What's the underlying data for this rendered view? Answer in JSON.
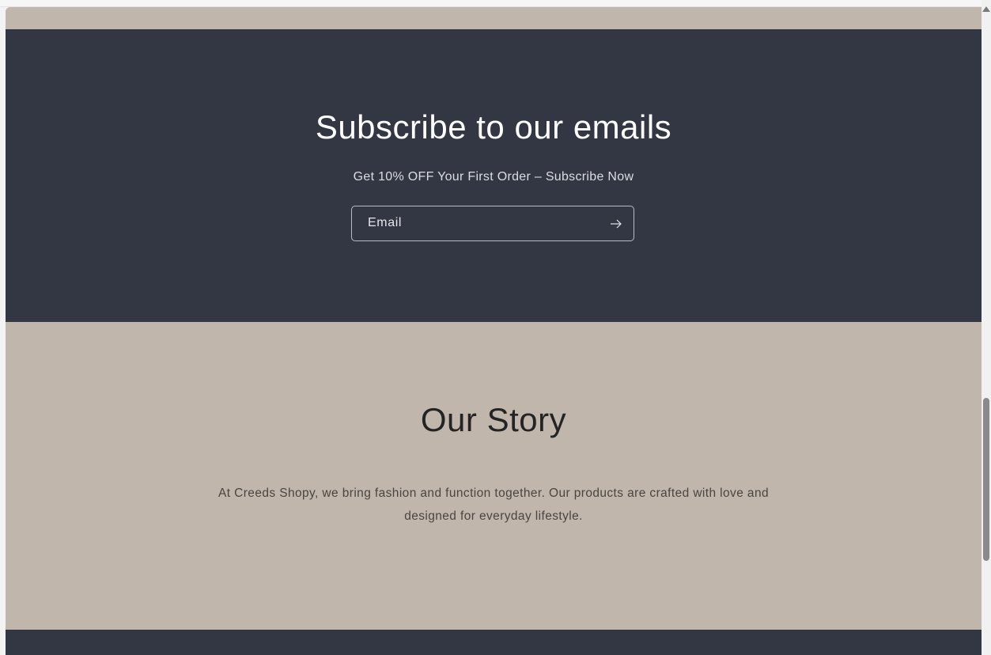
{
  "newsletter": {
    "title": "Subscribe to our emails",
    "subtitle": "Get 10% OFF Your First Order – Subscribe Now",
    "email_placeholder": "Email",
    "submit_icon": "arrow-right-icon"
  },
  "story": {
    "title": "Our Story",
    "text": "At Creeds Shopy, we bring fashion and function together. Our products are crafted with love and designed for everyday lifestyle."
  },
  "colors": {
    "dark_band": "#323743",
    "beige_band": "#c0b6ac",
    "heading_light": "#ffffff",
    "heading_dark": "#242424"
  }
}
